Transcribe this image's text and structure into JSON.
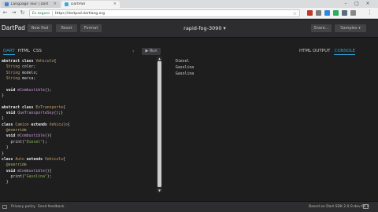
{
  "browser": {
    "tabs": [
      {
        "title": "Language Tour | Dart",
        "favicon_color": "#3a83d6"
      },
      {
        "title": "DartPad",
        "favicon_color": "#3ea9e0"
      }
    ],
    "secure_label": "Es seguro",
    "url": "https://dartpad.dartlang.org"
  },
  "dartpad": {
    "logo": "DartPad",
    "buttons": {
      "new_pad": "New Pad",
      "reset": "Reset",
      "format": "Format",
      "share": "Share...",
      "samples": "Samples ▾"
    },
    "title": "rapid-fog-3090 ▾",
    "editor_tabs": [
      "DART",
      "HTML",
      "CSS"
    ],
    "run_label": "▶ Run",
    "output_tabs": [
      "HTML OUTPUT",
      "CONSOLE"
    ]
  },
  "code_lines": [
    [
      {
        "t": "abstract class ",
        "c": "kw"
      },
      {
        "t": "Vehiculo",
        "c": "ty"
      },
      {
        "t": "{",
        "c": ""
      }
    ],
    [
      {
        "t": "  String ",
        "c": "ty"
      },
      {
        "t": "color;",
        "c": ""
      }
    ],
    [
      {
        "t": "  String ",
        "c": "ty"
      },
      {
        "t": "modelo;",
        "c": ""
      }
    ],
    [
      {
        "t": "  String ",
        "c": "ty"
      },
      {
        "t": "marca;",
        "c": ""
      }
    ],
    [
      {
        "t": "",
        "c": ""
      }
    ],
    [
      {
        "t": "  void ",
        "c": "kw"
      },
      {
        "t": "mCombustible",
        "c": "fn"
      },
      {
        "t": "();",
        "c": ""
      }
    ],
    [
      {
        "t": "}",
        "c": ""
      }
    ],
    [
      {
        "t": "",
        "c": ""
      }
    ],
    [
      {
        "t": "abstract class ",
        "c": "kw"
      },
      {
        "t": "ExTransporte",
        "c": "ty"
      },
      {
        "t": "{",
        "c": ""
      }
    ],
    [
      {
        "t": "  void ",
        "c": "kw"
      },
      {
        "t": "QueTransporteSoy",
        "c": "fn"
      },
      {
        "t": "();}",
        "c": ""
      }
    ],
    [
      {
        "t": "}",
        "c": ""
      }
    ],
    [
      {
        "t": "class ",
        "c": "kw"
      },
      {
        "t": "Camion ",
        "c": "ty"
      },
      {
        "t": "extends ",
        "c": "kw"
      },
      {
        "t": "Vehiculo",
        "c": "ty"
      },
      {
        "t": "{",
        "c": ""
      }
    ],
    [
      {
        "t": "  @override",
        "c": "an"
      }
    ],
    [
      {
        "t": "  void ",
        "c": "kw"
      },
      {
        "t": "mCombustible",
        "c": "fn"
      },
      {
        "t": "(){",
        "c": ""
      }
    ],
    [
      {
        "t": "    print(",
        "c": ""
      },
      {
        "t": "\"Diesel\"",
        "c": "st"
      },
      {
        "t": ");",
        "c": ""
      }
    ],
    [
      {
        "t": "  }",
        "c": ""
      }
    ],
    [
      {
        "t": "}",
        "c": ""
      }
    ],
    [
      {
        "t": "class ",
        "c": "kw"
      },
      {
        "t": "Auto ",
        "c": "ty"
      },
      {
        "t": "extends ",
        "c": "kw"
      },
      {
        "t": "Vehiculo",
        "c": "ty"
      },
      {
        "t": "{",
        "c": ""
      }
    ],
    [
      {
        "t": "  @override",
        "c": "an"
      }
    ],
    [
      {
        "t": "  void ",
        "c": "kw"
      },
      {
        "t": "mCombustible",
        "c": "fn"
      },
      {
        "t": "(){",
        "c": ""
      }
    ],
    [
      {
        "t": "    print(",
        "c": ""
      },
      {
        "t": "\"Gasolina\"",
        "c": "st"
      },
      {
        "t": ");",
        "c": ""
      }
    ],
    [
      {
        "t": "  }",
        "c": ""
      }
    ]
  ],
  "console_lines": [
    "Diesel",
    "Gasolina",
    "Gasolina"
  ],
  "footer": {
    "privacy": "Privacy policy",
    "feedback": "Send feedback",
    "sdk": "Based on Dart SDK 2.0.0-dev.69.0"
  },
  "colors": {
    "header_bg": "#2d2d2f",
    "editor_bg": "#1e1e1e",
    "accent": "#2b9fd4"
  }
}
